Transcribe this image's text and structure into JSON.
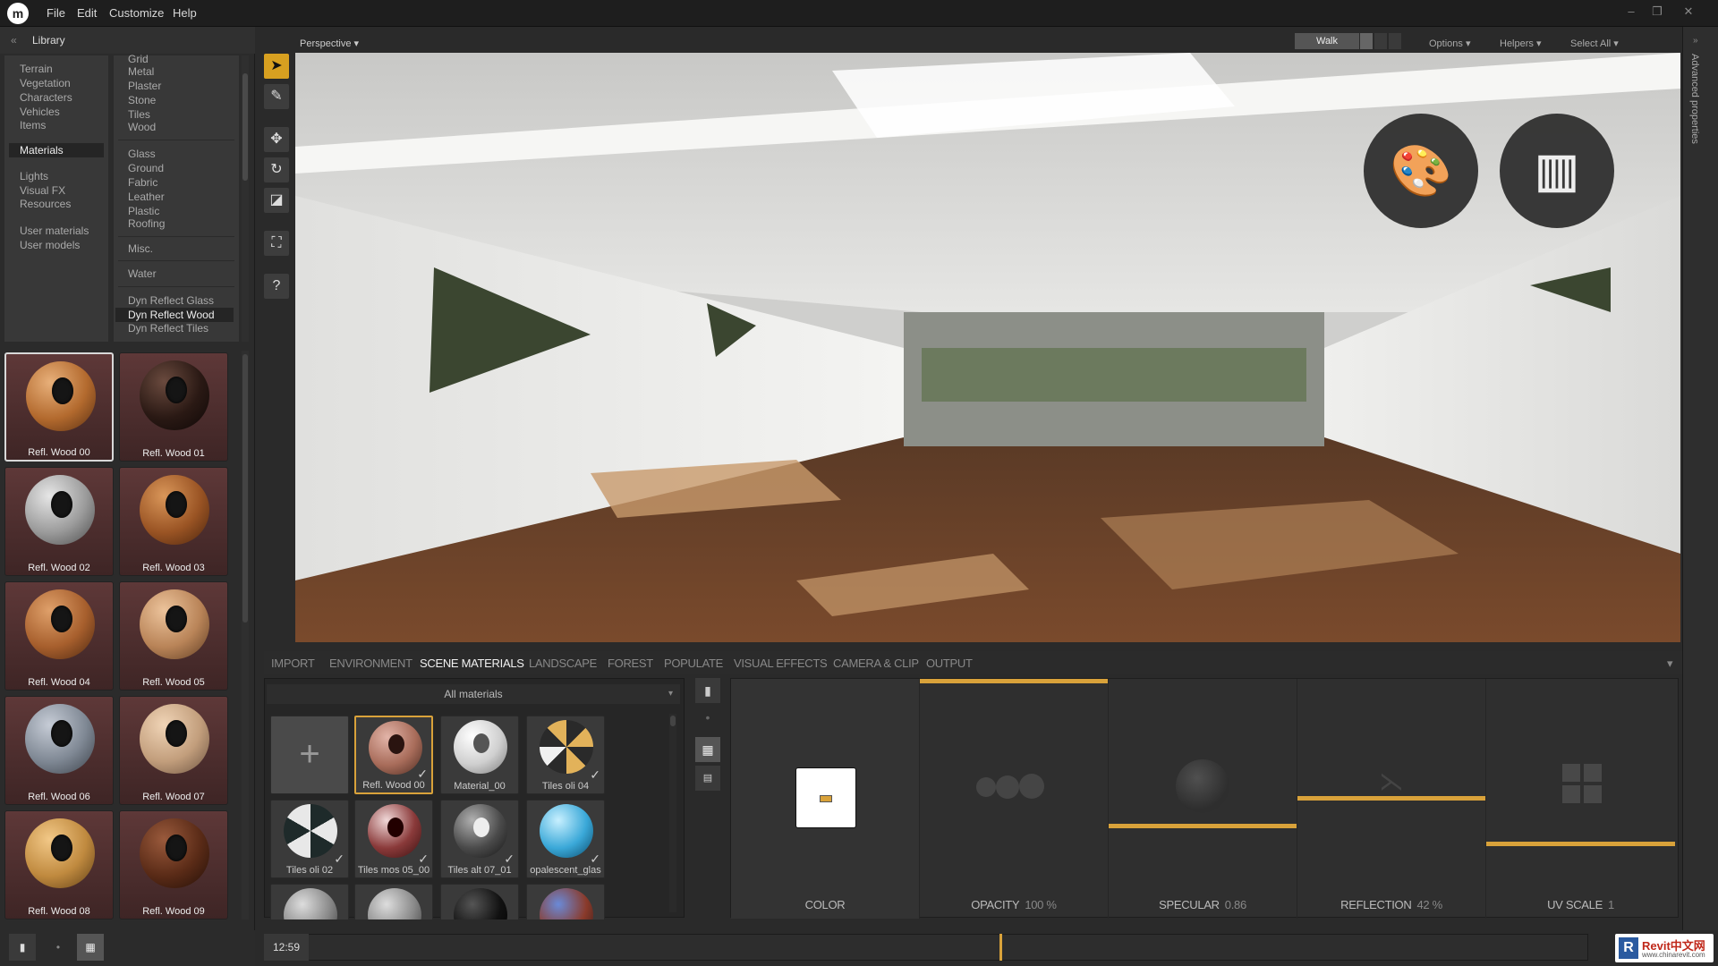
{
  "menu": {
    "file": "File",
    "edit": "Edit",
    "customize": "Customize",
    "help": "Help"
  },
  "library": {
    "title": "Library",
    "categories": [
      "Terrain",
      "Vegetation",
      "Characters",
      "Vehicles",
      "Items",
      "Materials",
      "Lights",
      "Visual FX",
      "Resources",
      "User materials",
      "User models"
    ],
    "selected_category": "Materials",
    "subcategories": [
      "Grid",
      "Metal",
      "Plaster",
      "Stone",
      "Tiles",
      "Wood",
      "Glass",
      "Ground",
      "Fabric",
      "Leather",
      "Plastic",
      "Roofing",
      "Misc.",
      "Water",
      "Dyn Reflect Glass",
      "Dyn Reflect Wood",
      "Dyn Reflect Tiles"
    ],
    "selected_subcategory": "Dyn Reflect Wood",
    "materials": [
      "Refl. Wood 00",
      "Refl. Wood 01",
      "Refl. Wood 02",
      "Refl. Wood 03",
      "Refl. Wood 04",
      "Refl. Wood 05",
      "Refl. Wood 06",
      "Refl. Wood 07",
      "Refl. Wood 08",
      "Refl. Wood 09"
    ]
  },
  "viewport": {
    "camera": "Perspective",
    "walk": "Walk",
    "options": "Options",
    "helpers": "Helpers",
    "select_all": "Select All"
  },
  "right_panel": {
    "label": "Advanced properties"
  },
  "tabs": [
    "IMPORT",
    "ENVIRONMENT",
    "SCENE MATERIALS",
    "LANDSCAPE",
    "FOREST",
    "POPULATE",
    "VISUAL EFFECTS",
    "CAMERA & CLIP",
    "OUTPUT"
  ],
  "active_tab": "SCENE MATERIALS",
  "scene_materials": {
    "filter": "All materials",
    "items": [
      "Refl. Wood 00",
      "Material_00",
      "Tiles oli 04",
      "Tiles oli 02",
      "Tiles mos 05_00",
      "Tiles alt 07_01",
      "opalescent_glas"
    ]
  },
  "properties": {
    "color": "COLOR",
    "opacity": "OPACITY",
    "opacity_value": "100 %",
    "specular": "SPECULAR",
    "specular_value": "0.86",
    "reflection": "REFLECTION",
    "reflection_value": "42 %",
    "uv_scale": "UV SCALE",
    "uv_scale_value": "1"
  },
  "timeline": {
    "time": "12:59"
  },
  "watermark": {
    "text": "Revit中文网",
    "sub": "www.chinarevit.com"
  },
  "colors": {
    "accent": "#d9a23a",
    "bg": "#2a2a2a"
  }
}
